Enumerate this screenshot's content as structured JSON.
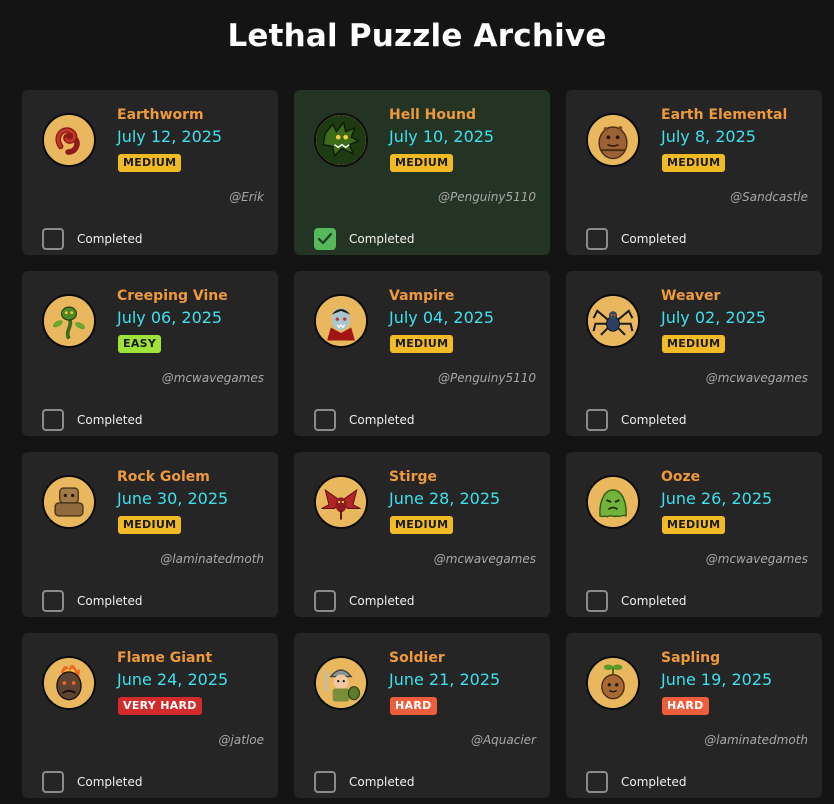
{
  "page": {
    "title": "Lethal Puzzle Archive"
  },
  "completed_label": "Completed",
  "colors": {
    "background": "#141414",
    "card": "#252525",
    "card_completed": "#243424",
    "name": "#ee9a3c",
    "date": "#3ee0ee",
    "badge_medium": "#f2bb25",
    "badge_easy": "#9fe33a",
    "badge_hard": "#ee5d3c",
    "badge_very_hard": "#d22b2b",
    "check_on": "#55b85a"
  },
  "puzzles": [
    {
      "name": "Earthworm",
      "date": "July 12, 2025",
      "difficulty": "MEDIUM",
      "author": "@Erik",
      "completed": false,
      "icon": "earthworm-icon"
    },
    {
      "name": "Hell Hound",
      "date": "July 10, 2025",
      "difficulty": "MEDIUM",
      "author": "@Penguiny5110",
      "completed": true,
      "icon": "hell-hound-icon"
    },
    {
      "name": "Earth Elemental",
      "date": "July 8, 2025",
      "difficulty": "MEDIUM",
      "author": "@Sandcastle",
      "completed": false,
      "icon": "earth-elemental-icon"
    },
    {
      "name": "Creeping Vine",
      "date": "July 06, 2025",
      "difficulty": "EASY",
      "author": "@mcwavegames",
      "completed": false,
      "icon": "creeping-vine-icon"
    },
    {
      "name": "Vampire",
      "date": "July 04, 2025",
      "difficulty": "MEDIUM",
      "author": "@Penguiny5110",
      "completed": false,
      "icon": "vampire-icon"
    },
    {
      "name": "Weaver",
      "date": "July 02, 2025",
      "difficulty": "MEDIUM",
      "author": "@mcwavegames",
      "completed": false,
      "icon": "spider-icon"
    },
    {
      "name": "Rock Golem",
      "date": "June 30, 2025",
      "difficulty": "MEDIUM",
      "author": "@laminatedmoth",
      "completed": false,
      "icon": "rock-golem-icon"
    },
    {
      "name": "Stirge",
      "date": "June 28, 2025",
      "difficulty": "MEDIUM",
      "author": "@mcwavegames",
      "completed": false,
      "icon": "stirge-icon"
    },
    {
      "name": "Ooze",
      "date": "June 26, 2025",
      "difficulty": "MEDIUM",
      "author": "@mcwavegames",
      "completed": false,
      "icon": "ooze-icon"
    },
    {
      "name": "Flame Giant",
      "date": "June 24, 2025",
      "difficulty": "VERY HARD",
      "author": "@jatloe",
      "completed": false,
      "icon": "flame-giant-icon"
    },
    {
      "name": "Soldier",
      "date": "June 21, 2025",
      "difficulty": "HARD",
      "author": "@Aquacier",
      "completed": false,
      "icon": "soldier-icon"
    },
    {
      "name": "Sapling",
      "date": "June 19, 2025",
      "difficulty": "HARD",
      "author": "@laminatedmoth",
      "completed": false,
      "icon": "sapling-icon"
    }
  ]
}
